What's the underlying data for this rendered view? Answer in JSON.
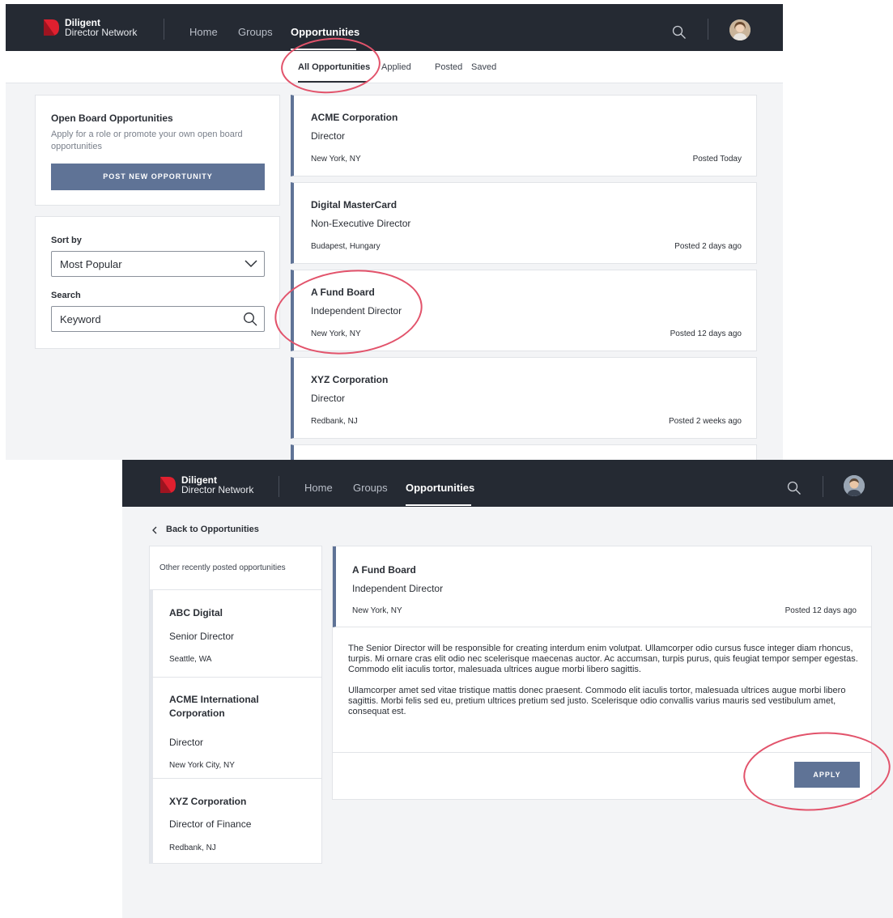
{
  "brand": {
    "name": "Diligent",
    "product": "Director Network",
    "accent_color": "#e0202f",
    "nav_bg": "#252a33",
    "button_color": "#5f7396"
  },
  "nav": {
    "items": [
      "Home",
      "Groups",
      "Opportunities"
    ],
    "active": "Opportunities"
  },
  "list_view": {
    "tabs": [
      "All Opportunities",
      "Applied",
      "Posted",
      "Saved"
    ],
    "active_tab": "All Opportunities",
    "promo": {
      "title": "Open Board Opportunities",
      "description": "Apply for a role or promote your own open board opportunities",
      "button": "POST NEW OPPORTUNITY"
    },
    "filters": {
      "sort_label": "Sort by",
      "sort_value": "Most Popular",
      "search_label": "Search",
      "search_placeholder": "Keyword"
    },
    "opportunities": [
      {
        "company": "ACME Corporation",
        "role": "Director",
        "location": "New York, NY",
        "posted": "Posted Today"
      },
      {
        "company": "Digital MasterCard",
        "role": "Non-Executive Director",
        "location": "Budapest, Hungary",
        "posted": "Posted 2 days ago"
      },
      {
        "company": "A Fund Board",
        "role": "Independent Director",
        "location": "New York, NY",
        "posted": "Posted 12 days ago"
      },
      {
        "company": "XYZ Corporation",
        "role": "Director",
        "location": "Redbank, NJ",
        "posted": "Posted 2 weeks ago"
      }
    ]
  },
  "detail_view": {
    "back": "Back to Opportunities",
    "sidebar_title": "Other recently posted opportunities",
    "others": [
      {
        "company": "ABC Digital",
        "role": "Senior Director",
        "location": "Seattle, WA"
      },
      {
        "company": "ACME International Corporation",
        "role": "Director",
        "location": "New York City, NY"
      },
      {
        "company": "XYZ Corporation",
        "role": "Director of Finance",
        "location": "Redbank, NJ"
      }
    ],
    "selected": {
      "company": "A Fund Board",
      "role": "Independent Director",
      "location": "New York, NY",
      "posted": "Posted 12 days ago",
      "paragraph1": "The Senior Director will be responsible for creating interdum enim volutpat. Ullamcorper odio cursus fusce integer diam rhoncus, turpis. Mi ornare cras elit odio nec scelerisque maecenas auctor. Ac accumsan, turpis purus, quis feugiat tempor semper egestas. Commodo elit iaculis tortor, malesuada ultrices augue morbi libero sagittis.",
      "paragraph2": "Ullamcorper amet sed vitae tristique mattis donec praesent. Commodo elit iaculis tortor, malesuada ultrices augue morbi libero sagittis. Morbi felis sed eu, pretium ultrices pretium sed justo. Scelerisque odio convallis varius mauris sed vestibulum amet, consequat est.",
      "apply": "APPLY"
    }
  },
  "annotation_color": "#e2536b"
}
